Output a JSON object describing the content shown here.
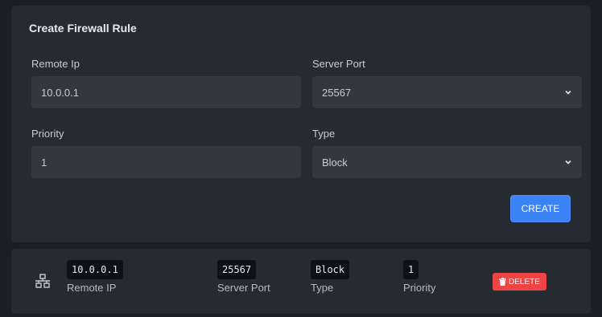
{
  "form": {
    "title": "Create Firewall Rule",
    "remote_ip": {
      "label": "Remote Ip",
      "value": "10.0.0.1"
    },
    "server_port": {
      "label": "Server Port",
      "value": "25567"
    },
    "priority": {
      "label": "Priority",
      "value": "1"
    },
    "type": {
      "label": "Type",
      "value": "Block"
    },
    "create_label": "CREATE"
  },
  "rules": [
    {
      "remote_ip": "10.0.0.1",
      "remote_ip_label": "Remote IP",
      "server_port": "25567",
      "server_port_label": "Server Port",
      "type": "Block",
      "type_label": "Type",
      "priority": "1",
      "priority_label": "Priority",
      "delete_label": "DELETE"
    }
  ],
  "icons": {
    "rule": "network-icon",
    "delete": "trash-icon",
    "select": "chevron-down-icon"
  },
  "colors": {
    "primary": "#3b82f6",
    "danger": "#ef4444",
    "panel": "#262a32",
    "input": "#333741"
  }
}
